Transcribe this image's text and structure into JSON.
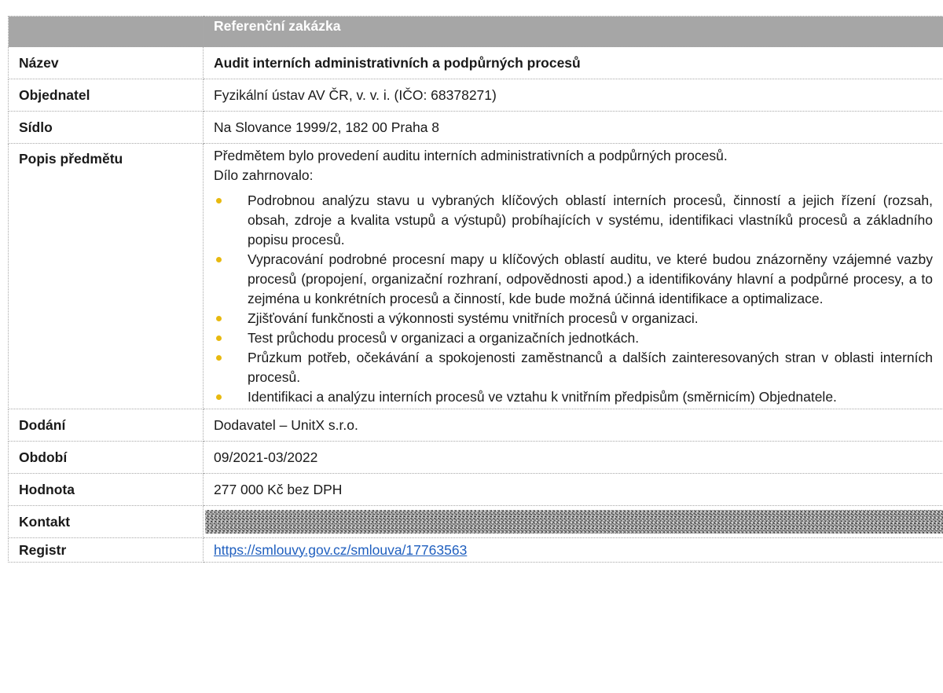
{
  "table": {
    "header": "Referenční zakázka",
    "rows": {
      "name": {
        "label": "Název",
        "value": "Audit interních administrativních a podpůrných procesů"
      },
      "client": {
        "label": "Objednatel",
        "value": "Fyzikální ústav AV ČR, v. v. i. (IČO: 68378271)"
      },
      "seat": {
        "label": "Sídlo",
        "value": "Na Slovance 1999/2, 182 00 Praha 8"
      },
      "description": {
        "label": "Popis předmětu",
        "intro_line1": "Předmětem bylo provedení auditu interních administrativních a podpůrných procesů.",
        "intro_line2": "Dílo zahrnovalo:",
        "items": [
          "Podrobnou analýzu stavu u vybraných klíčových oblastí interních procesů, činností a jejich řízení (rozsah, obsah, zdroje a kvalita vstupů a výstupů) probíhajících v systému, identifikaci vlastníků procesů a základního popisu procesů.",
          "Vypracování podrobné procesní mapy u klíčových oblastí auditu, ve které budou znázorněny vzájemné vazby procesů (propojení, organizační rozhraní, odpovědnosti apod.) a identifikovány hlavní a podpůrné procesy, a to zejména u konkrétních procesů a činností, kde bude možná účinná identifikace a optimalizace.",
          "Zjišťování funkčnosti a výkonnosti systému vnitřních procesů v organizaci.",
          "Test průchodu procesů v organizaci a organizačních jednotkách.",
          "Průzkum potřeb, očekávání a spokojenosti zaměstnanců a dalších zainteresovaných stran v oblasti interních procesů.",
          "Identifikaci a analýzu interních procesů ve vztahu k vnitřním předpisům (směrnicím) Objednatele."
        ]
      },
      "delivery": {
        "label": "Dodání",
        "value": "Dodavatel – UnitX s.r.o."
      },
      "period": {
        "label": "Období",
        "value": "09/2021-03/2022"
      },
      "price": {
        "label": "Hodnota",
        "value": "277 000 Kč bez DPH"
      },
      "contact": {
        "label": "Kontakt",
        "value_state": "redacted"
      },
      "registry": {
        "label": "Registr",
        "value": "https://smlouvy.gov.cz/smlouva/17763563"
      }
    }
  },
  "colors": {
    "header_bg": "#a6a6a6",
    "header_text": "#ffffff",
    "bullet": "#e8b90f",
    "link": "#1f5fbf",
    "border": "#a8a8a8"
  }
}
